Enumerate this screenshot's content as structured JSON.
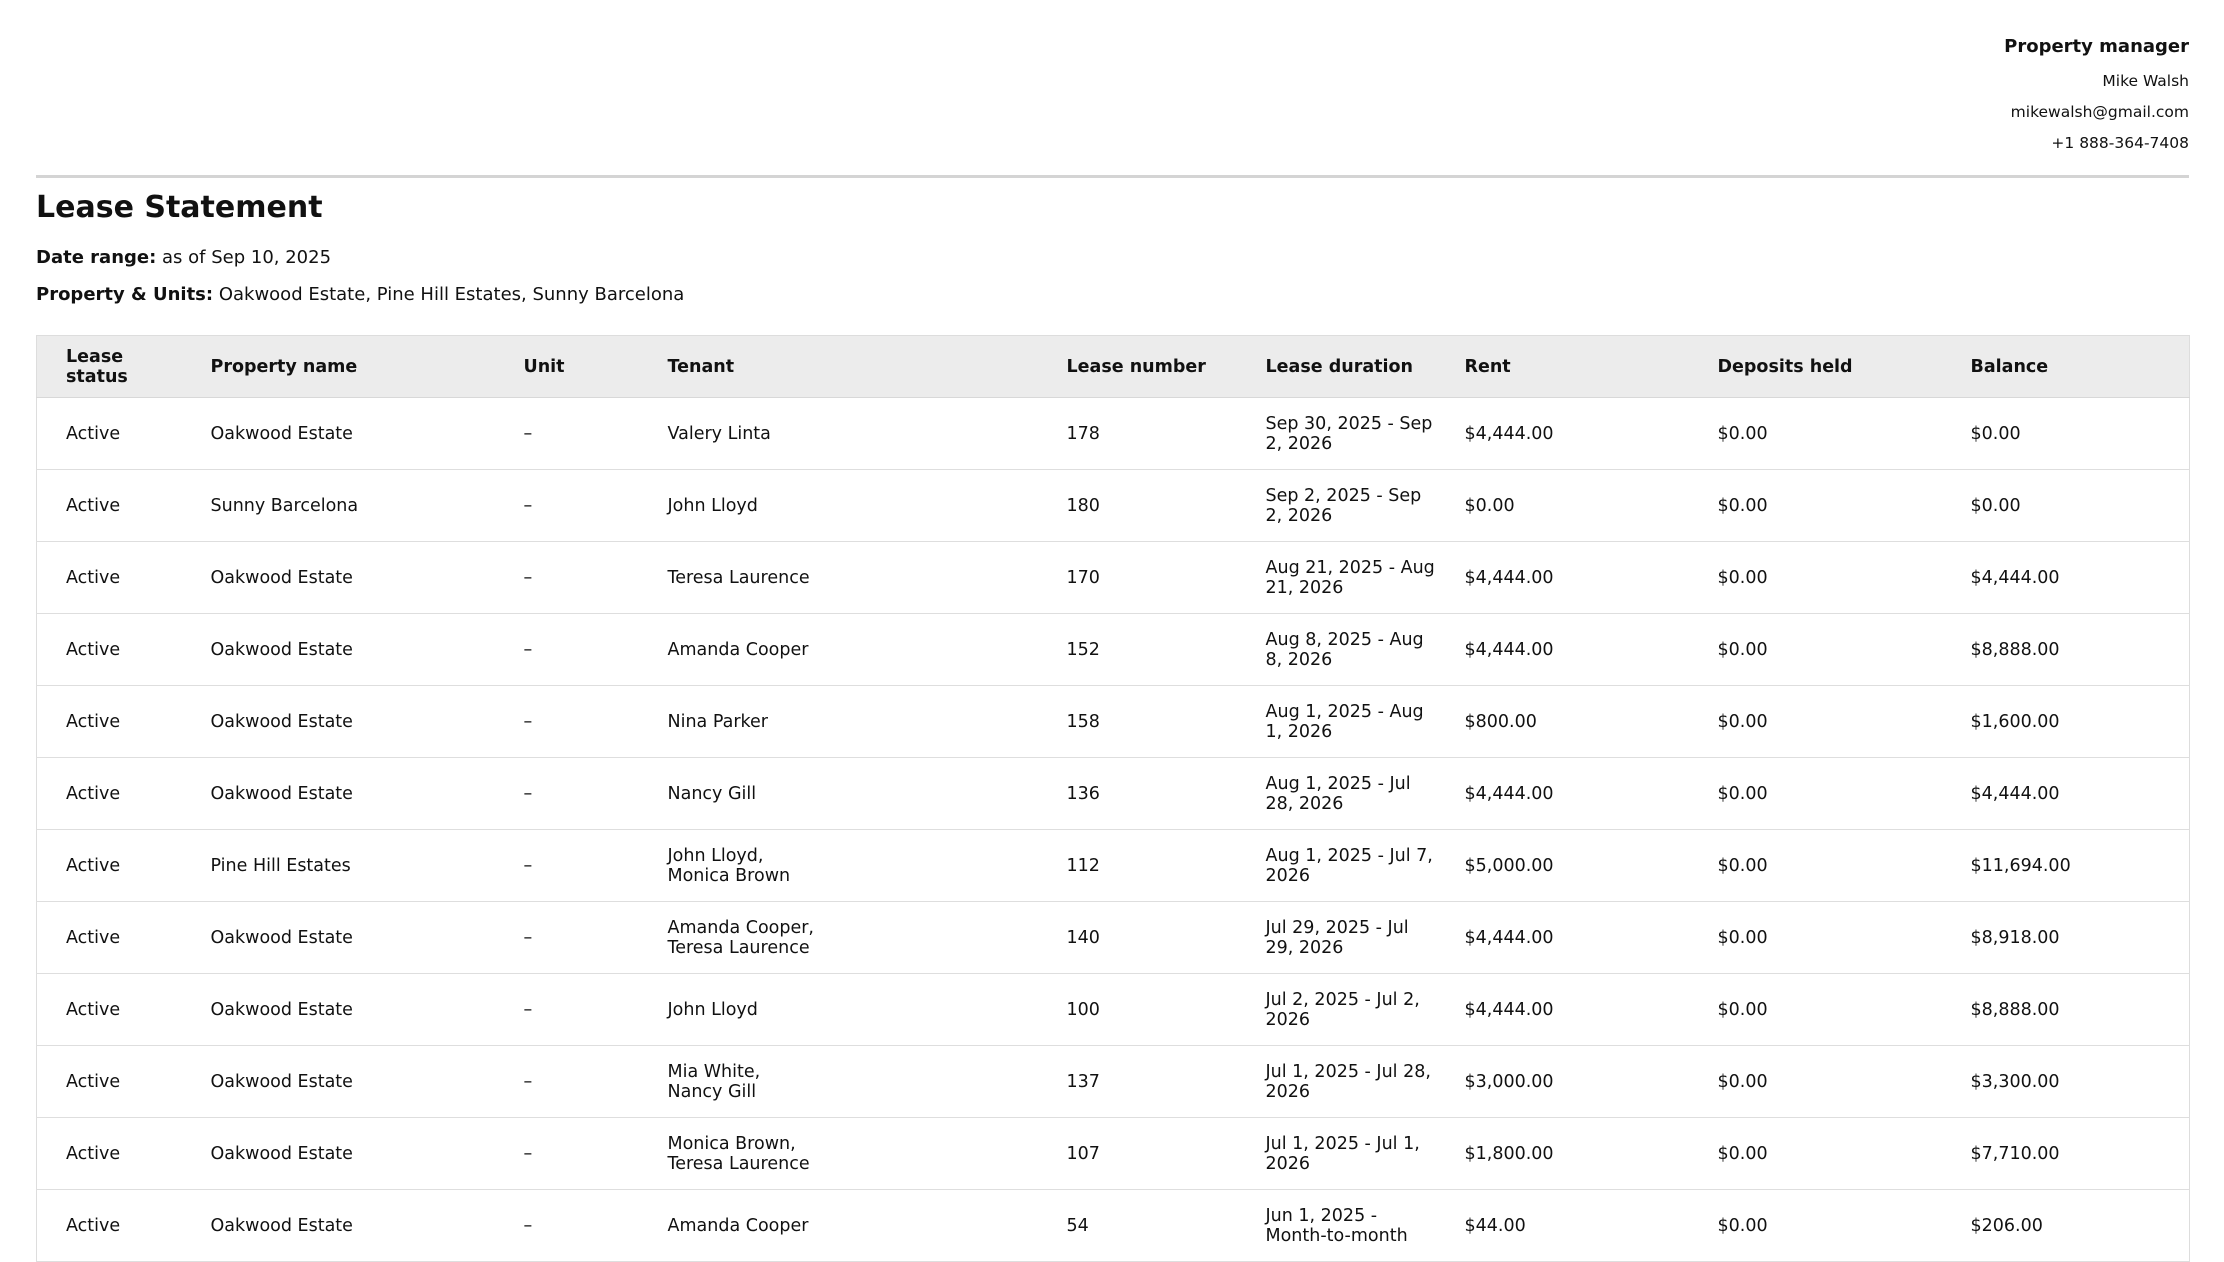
{
  "manager": {
    "heading": "Property manager",
    "name": "Mike Walsh",
    "email": "mikewalsh@gmail.com",
    "phone": "+1 888-364-7408"
  },
  "statement": {
    "title": "Lease Statement",
    "date_range_label": "Date range:",
    "date_range_value": "as of Sep 10, 2025",
    "property_units_label": "Property & Units:",
    "property_units_value": "Oakwood Estate, Pine Hill Estates, Sunny Barcelona"
  },
  "table": {
    "columns": [
      "Lease status",
      "Property name",
      "Unit",
      "Tenant",
      "Lease number",
      "Lease duration",
      "Rent",
      "Deposits held",
      "Balance"
    ],
    "rows": [
      [
        "Active",
        "Oakwood Estate",
        "–",
        "Valery Linta",
        "178",
        "Sep 30, 2025 - Sep 2, 2026",
        "$4,444.00",
        "$0.00",
        "$0.00"
      ],
      [
        "Active",
        "Sunny Barcelona",
        "–",
        "John Lloyd",
        "180",
        "Sep 2, 2025 - Sep 2, 2026",
        "$0.00",
        "$0.00",
        "$0.00"
      ],
      [
        "Active",
        "Oakwood Estate",
        "–",
        "Teresa Laurence",
        "170",
        "Aug 21, 2025 - Aug 21, 2026",
        "$4,444.00",
        "$0.00",
        "$4,444.00"
      ],
      [
        "Active",
        "Oakwood Estate",
        "–",
        "Amanda Cooper",
        "152",
        "Aug 8, 2025 - Aug 8, 2026",
        "$4,444.00",
        "$0.00",
        "$8,888.00"
      ],
      [
        "Active",
        "Oakwood Estate",
        "–",
        "Nina Parker",
        "158",
        "Aug 1, 2025 - Aug 1, 2026",
        "$800.00",
        "$0.00",
        "$1,600.00"
      ],
      [
        "Active",
        "Oakwood Estate",
        "–",
        "Nancy Gill",
        "136",
        "Aug 1, 2025 - Jul 28, 2026",
        "$4,444.00",
        "$0.00",
        "$4,444.00"
      ],
      [
        "Active",
        "Pine Hill Estates",
        "–",
        "John Lloyd,\nMonica Brown",
        "112",
        "Aug 1, 2025 - Jul 7, 2026",
        "$5,000.00",
        "$0.00",
        "$11,694.00"
      ],
      [
        "Active",
        "Oakwood Estate",
        "–",
        "Amanda Cooper,\nTeresa Laurence",
        "140",
        "Jul 29, 2025 - Jul 29, 2026",
        "$4,444.00",
        "$0.00",
        "$8,918.00"
      ],
      [
        "Active",
        "Oakwood Estate",
        "–",
        "John Lloyd",
        "100",
        "Jul 2, 2025 - Jul 2, 2026",
        "$4,444.00",
        "$0.00",
        "$8,888.00"
      ],
      [
        "Active",
        "Oakwood Estate",
        "–",
        "Mia White,\nNancy Gill",
        "137",
        "Jul 1, 2025 - Jul 28, 2026",
        "$3,000.00",
        "$0.00",
        "$3,300.00"
      ],
      [
        "Active",
        "Oakwood Estate",
        "–",
        "Monica Brown,\nTeresa Laurence",
        "107",
        "Jul 1, 2025 - Jul 1, 2026",
        "$1,800.00",
        "$0.00",
        "$7,710.00"
      ],
      [
        "Active",
        "Oakwood Estate",
        "–",
        "Amanda Cooper",
        "54",
        "Jun 1, 2025 - Month-to-month",
        "$44.00",
        "$0.00",
        "$206.00"
      ]
    ]
  }
}
